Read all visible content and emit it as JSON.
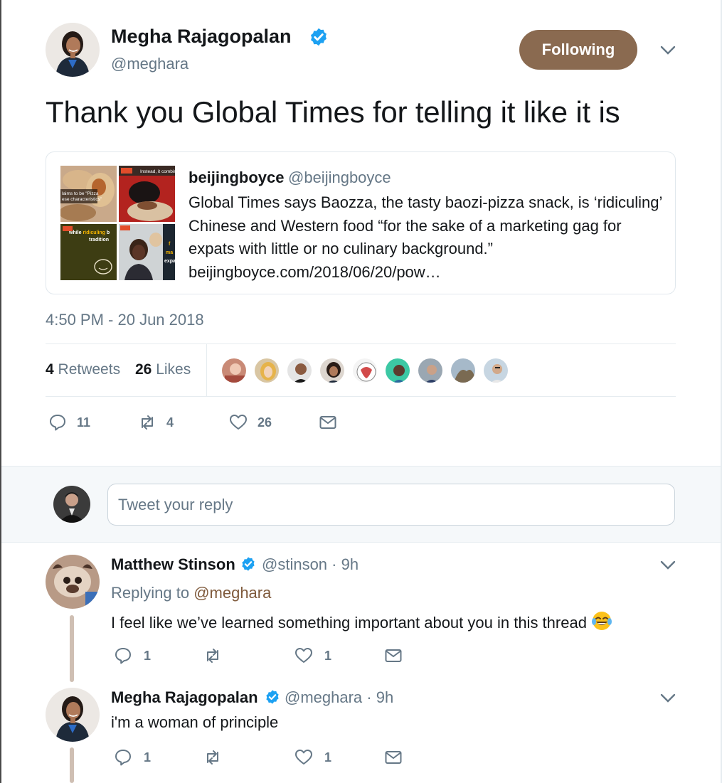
{
  "colors": {
    "accent": "#8a6a50",
    "link": "#7f5a3c",
    "verified": "#1da1f2",
    "muted": "#657786",
    "text": "#14171a",
    "thread_line": "#cfbfb3"
  },
  "tweet": {
    "author_name": "Megha Rajagopalan",
    "author_handle": "@meghara",
    "follow_label": "Following",
    "text": "Thank you Global Times for telling it like it is",
    "timestamp": "4:50 PM - 20 Jun 2018",
    "quote": {
      "name": "beijingboyce",
      "handle": "@beijingboyce",
      "body": "Global Times says Baozza, the tasty baozi-pizza snack, is ‘ridiculing’ Chinese and Western food “for the sake of a marketing gag for expats with little or no culinary background.” beijingboyce.com/2018/06/20/pow…",
      "image_texts": {
        "img1": "laims to be \"Pizza\nese characteristics\"",
        "img2": "Instead, it combines",
        "img3": "while ridiculing b\ntradition",
        "img4": "f\nma\nexpa"
      }
    },
    "stats": {
      "retweets_count": "4",
      "retweets_label": "Retweets",
      "likes_count": "26",
      "likes_label": "Likes"
    },
    "actions": {
      "reply_count": "11",
      "retweet_count": "4",
      "like_count": "26"
    }
  },
  "reply_box": {
    "placeholder": "Tweet your reply"
  },
  "replies": [
    {
      "name": "Matthew Stinson",
      "handle": "@stinson",
      "time": "· 9h",
      "replying_prefix": "Replying to ",
      "replying_to": "@meghara",
      "text": "I feel like we’ve learned something important about you in this thread",
      "reply_count": "1",
      "like_count": "1"
    },
    {
      "name": "Megha Rajagopalan",
      "handle": "@meghara",
      "time": "· 9h",
      "text": "i'm a woman of principle",
      "reply_count": "1",
      "like_count": "1"
    }
  ],
  "icons": {
    "verified": "verified-badge-icon",
    "caret": "chevron-down-icon",
    "reply": "reply-icon",
    "retweet": "retweet-icon",
    "like": "heart-icon",
    "dm": "envelope-icon",
    "emoji": "face-with-tears-of-joy"
  }
}
